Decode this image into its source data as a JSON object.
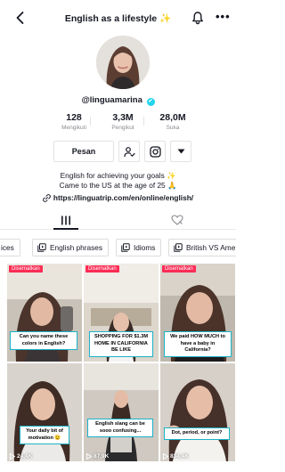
{
  "header": {
    "title": "English as a lifestyle",
    "title_sparkle": "✨"
  },
  "profile": {
    "username": "@linguamarina",
    "verified_mark": "✔"
  },
  "stats": [
    {
      "value": "128",
      "label": "Mengikuti"
    },
    {
      "value": "3,3M",
      "label": "Pengikut"
    },
    {
      "value": "28,0M",
      "label": "Suka"
    }
  ],
  "actions": {
    "message_label": "Pesan"
  },
  "bio": {
    "line1": "English for achieving your goals ✨",
    "line2": "Came to the US at the age of 25 🙏",
    "link": "https://linguatrip.com/en/online/english/"
  },
  "playlists": [
    {
      "label": "ices"
    },
    {
      "label": "English phrases"
    },
    {
      "label": "Idioms"
    },
    {
      "label": "British VS Ame"
    }
  ],
  "videos": [
    {
      "pinned": "Disematkan",
      "caption": "Can you name these colors in English?",
      "views": ""
    },
    {
      "pinned": "Disematkan",
      "caption": "SHOPPING FOR $1.3M HOME IN CALIFORNIA BE LIKE",
      "views": ""
    },
    {
      "pinned": "Disematkan",
      "caption": "We paid HOW MUCH to have a baby in California?",
      "views": ""
    },
    {
      "pinned": "",
      "caption": "Your daily bit of motivation 😉",
      "views": "24,4K"
    },
    {
      "pinned": "",
      "caption": "English slang can be sooo confusing...",
      "views": "87,9K"
    },
    {
      "pinned": "",
      "caption": "Dot, period, or point?",
      "views": "834,4K"
    }
  ],
  "colors": {
    "accent_red": "#fe2c55",
    "verified_blue": "#20d5ec",
    "caption_border": "#1bb3c7"
  }
}
